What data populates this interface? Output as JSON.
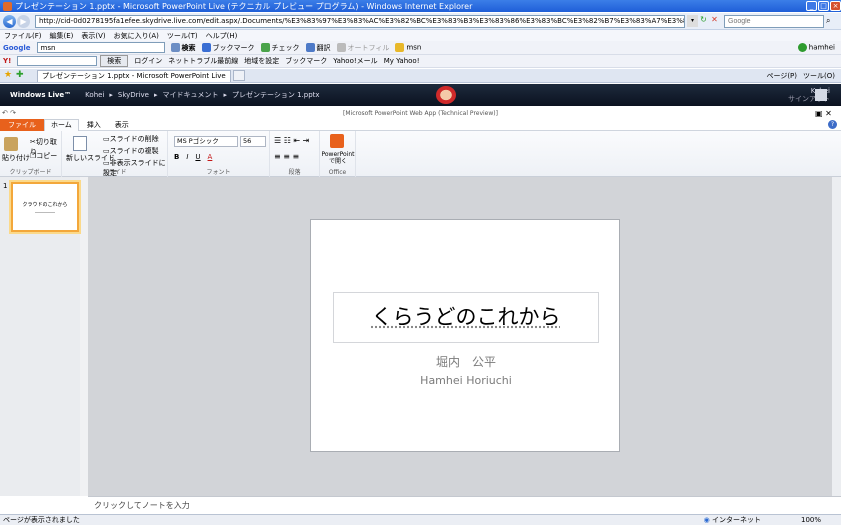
{
  "window": {
    "title": "プレゼンテーション 1.pptx - Microsoft PowerPoint Live (テクニカル プレビュー プログラム) - Windows Internet Explorer"
  },
  "address": {
    "url": "http://cid-0d0278195fa1efee.skydrive.live.com/edit.aspx/.Documents/%E3%83%97%E3%83%AC%E3%82%BC%E3%83%B3%E3%83%86%E3%83%BC%E3%82%B7%E3%83%A7%E3%83%B3%201.pptx?lnd=1",
    "search_placeholder": "Google"
  },
  "menu": [
    "ファイル(F)",
    "編集(E)",
    "表示(V)",
    "お気に入り(A)",
    "ツール(T)",
    "ヘルプ(H)"
  ],
  "google_toolbar": {
    "brand": "Google",
    "query": "msn",
    "items": [
      "検索",
      "ブックマーク",
      "チェック",
      "翻訳",
      "オートフィル",
      "msn"
    ],
    "user": "hamhei"
  },
  "yahoo_toolbar": {
    "search_button": "検索",
    "items": [
      "ログイン",
      "ネットトラブル最前線",
      "地域を設定",
      "ブックマーク",
      "Yahoo!メール",
      "My Yahoo!"
    ]
  },
  "tab": {
    "label": "プレゼンテーション 1.pptx - Microsoft PowerPoint Live"
  },
  "ie_commands": [
    "ページ(P)",
    "ツール(O)"
  ],
  "live_header": {
    "brand": "Windows Live™",
    "breadcrumbs": [
      "Kohei",
      "SkyDrive",
      "マイドキュメント",
      "プレゼンテーション 1.pptx"
    ],
    "user": "Kohei",
    "user_sub": "サインアウト"
  },
  "app_title": "[Microsoft PowerPoint Web App (Technical Preview)]",
  "ribbon_tabs": [
    "ファイル",
    "ホーム",
    "挿入",
    "表示"
  ],
  "ribbon": {
    "clipboard": {
      "paste": "貼り付け",
      "cut": "切り取り",
      "copy": "コピー",
      "label": "クリップボード"
    },
    "slides": {
      "new_slide": "新しいスライド",
      "delete": "スライドの削除",
      "duplicate": "スライドの複製",
      "hide": "非表示スライドに設定",
      "label": "スライド"
    },
    "font": {
      "name": "MS Pゴシック",
      "size": "56",
      "bold": "B",
      "italic": "I",
      "underline": "U",
      "color": "A",
      "label": "フォント"
    },
    "paragraph": {
      "label": "段落"
    },
    "office": {
      "open": "PowerPoint で開く",
      "label": "Office"
    }
  },
  "thumbnail": {
    "number": "1",
    "title": "クラウドのこれから"
  },
  "slide": {
    "title": "くらうどのこれから",
    "author_jp": "堀内　公平",
    "author_en": "Hamhei Horiuchi"
  },
  "notes_placeholder": "クリックしてノートを入力",
  "status": {
    "left": "ページが表示されました",
    "zone": "インターネット",
    "zoom": "100%"
  },
  "colors": {
    "accent_orange": "#e8611c",
    "selection": "#f3a73a",
    "titlebar": "#1f5ed8"
  }
}
